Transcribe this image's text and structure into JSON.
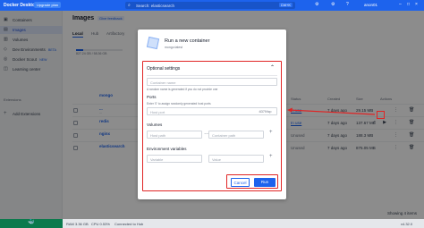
{
  "app": {
    "title": "Docker Desktop",
    "plan": "Upgrade plan",
    "search_placeholder": "Search: elasticsearch",
    "shortcut": "Ctrl+K",
    "user": "anon01"
  },
  "sidebar": {
    "items": [
      {
        "label": "Containers",
        "icon": "container-icon"
      },
      {
        "label": "Images",
        "icon": "image-icon",
        "active": true
      },
      {
        "label": "Volumes",
        "icon": "volume-icon"
      },
      {
        "label": "Dev Environments",
        "badge": "BETA",
        "icon": "dev-env-icon"
      },
      {
        "label": "Docker Scout",
        "badge": "NEW",
        "icon": "scout-icon"
      },
      {
        "label": "Learning center",
        "icon": "learning-icon"
      }
    ],
    "extensions_label": "Extensions",
    "add_extensions": "Add Extensions"
  },
  "main": {
    "title": "Images",
    "feedback": "Give feedback",
    "tabs": [
      "Local",
      "Hub",
      "Artifactory"
    ],
    "disk": {
      "used_text": "827.24 GB / 58.36 GB",
      "fill_fraction": 0.15
    },
    "columns": {
      "status": "Status",
      "created": "Created",
      "size": "Size",
      "actions": "Actions"
    },
    "rows": [
      {
        "name": "...",
        "sub": "...",
        "status": "In use",
        "status_link": true,
        "created": "7 days ago",
        "size": "29.15 MB"
      },
      {
        "name": "mongo",
        "sub": "",
        "status": "",
        "status_link": false,
        "created": "",
        "size": ""
      },
      {
        "name": "redis",
        "sub": "",
        "status": "In use",
        "status_link": true,
        "created": "7 days ago",
        "size": "137.67 MB"
      },
      {
        "name": "nginx",
        "sub": "",
        "status": "Unused",
        "status_link": false,
        "created": "7 days ago",
        "size": "188.3 MB"
      },
      {
        "name": "elasticsearch",
        "sub": "",
        "status": "Unused",
        "status_link": false,
        "created": "7 days ago",
        "size": "875.05 MB"
      }
    ],
    "showing": "Showing 4 items"
  },
  "status_bar": {
    "ram": "RAM 3.36 GB",
    "cpu": "CPU 0.53%",
    "connection": "Connected to Hub",
    "version": "v4.32.0"
  },
  "modal": {
    "title": "Run a new container",
    "subtitle": "mongo:latest",
    "optional_settings": "Optional settings",
    "container_name_placeholder": "Container name",
    "container_name_hint": "A random name is generated if you do not provide one",
    "ports_label": "Ports",
    "ports_hint": "Enter '0' to assign randomly generated host ports",
    "host_port_placeholder": "Host port",
    "container_port": ":6379/tcp",
    "volumes_label": "Volumes",
    "host_path_placeholder": "Host path",
    "container_path_placeholder": "Container path",
    "env_label": "Environment variables",
    "variable_placeholder": "Variable",
    "value_placeholder": "Value",
    "cancel": "Cancel",
    "run": "Run"
  }
}
